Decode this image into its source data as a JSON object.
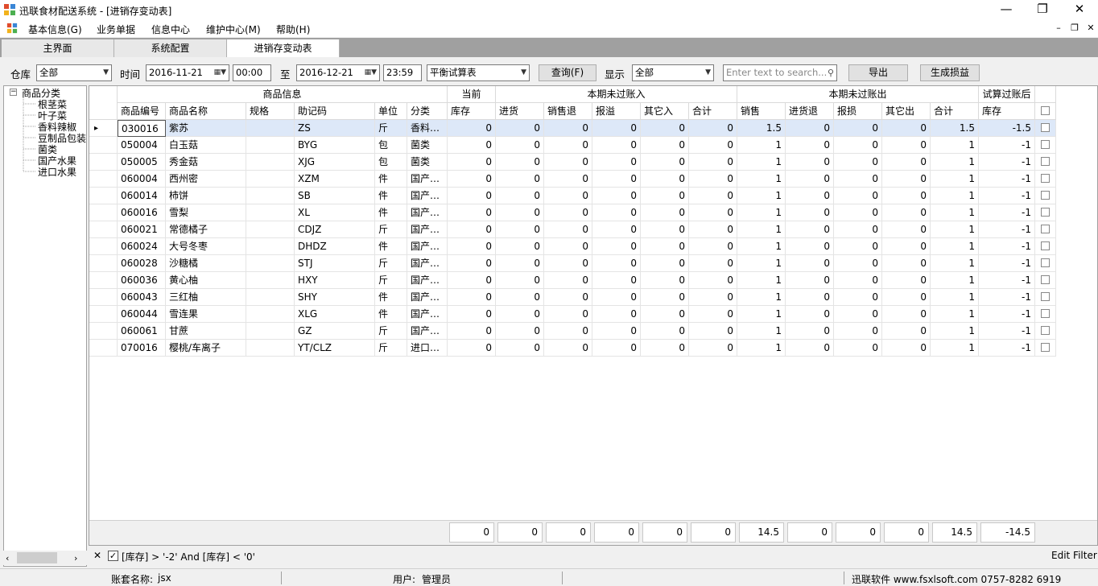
{
  "window": {
    "title": "迅联食材配送系统 - [进销存变动表]"
  },
  "menu": [
    "基本信息(G)",
    "业务单据",
    "信息中心",
    "维护中心(M)",
    "帮助(H)"
  ],
  "tabs": [
    "主界面",
    "系统配置",
    "进销存变动表"
  ],
  "toolbar": {
    "warehouse_label": "仓库",
    "warehouse_value": "全部",
    "time_label": "时间",
    "date_from": "2016-11-21",
    "time_from": "00:00",
    "to_label": "至",
    "date_to": "2016-12-21",
    "time_to": "23:59",
    "mode_value": "平衡试算表",
    "query_button": "查询(F)",
    "display_label": "显示",
    "display_value": "全部",
    "search_placeholder": "Enter text to search...",
    "export_button": "导出",
    "loss_button": "生成损益"
  },
  "tree": {
    "root": "商品分类",
    "children": [
      "根茎菜",
      "叶子菜",
      "香料辣椒",
      "豆制品包装",
      "菌类",
      "国产水果",
      "进口水果"
    ]
  },
  "grid": {
    "bands": [
      "商品信息",
      "当前",
      "本期未过账入",
      "本期未过账出",
      "试算过账后"
    ],
    "columns": [
      "商品编号",
      "商品名称",
      "规格",
      "助记码",
      "单位",
      "分类",
      "库存",
      "进货",
      "销售退",
      "报溢",
      "其它入",
      "合计",
      "销售",
      "进货退",
      "报损",
      "其它出",
      "合计",
      "库存"
    ],
    "rows": [
      [
        "030016",
        "紫苏",
        "",
        "ZS",
        "斤",
        "香料…",
        "0",
        "0",
        "0",
        "0",
        "0",
        "0",
        "1.5",
        "0",
        "0",
        "0",
        "1.5",
        "-1.5"
      ],
      [
        "050004",
        "白玉菇",
        "",
        "BYG",
        "包",
        "菌类",
        "0",
        "0",
        "0",
        "0",
        "0",
        "0",
        "1",
        "0",
        "0",
        "0",
        "1",
        "-1"
      ],
      [
        "050005",
        "秀金菇",
        "",
        "XJG",
        "包",
        "菌类",
        "0",
        "0",
        "0",
        "0",
        "0",
        "0",
        "1",
        "0",
        "0",
        "0",
        "1",
        "-1"
      ],
      [
        "060004",
        "西州密",
        "",
        "XZM",
        "件",
        "国产…",
        "0",
        "0",
        "0",
        "0",
        "0",
        "0",
        "1",
        "0",
        "0",
        "0",
        "1",
        "-1"
      ],
      [
        "060014",
        "柿饼",
        "",
        "SB",
        "件",
        "国产…",
        "0",
        "0",
        "0",
        "0",
        "0",
        "0",
        "1",
        "0",
        "0",
        "0",
        "1",
        "-1"
      ],
      [
        "060016",
        "雪梨",
        "",
        "XL",
        "件",
        "国产…",
        "0",
        "0",
        "0",
        "0",
        "0",
        "0",
        "1",
        "0",
        "0",
        "0",
        "1",
        "-1"
      ],
      [
        "060021",
        "常德橘子",
        "",
        "CDJZ",
        "斤",
        "国产…",
        "0",
        "0",
        "0",
        "0",
        "0",
        "0",
        "1",
        "0",
        "0",
        "0",
        "1",
        "-1"
      ],
      [
        "060024",
        "大号冬枣",
        "",
        "DHDZ",
        "件",
        "国产…",
        "0",
        "0",
        "0",
        "0",
        "0",
        "0",
        "1",
        "0",
        "0",
        "0",
        "1",
        "-1"
      ],
      [
        "060028",
        "沙糖橘",
        "",
        "STJ",
        "斤",
        "国产…",
        "0",
        "0",
        "0",
        "0",
        "0",
        "0",
        "1",
        "0",
        "0",
        "0",
        "1",
        "-1"
      ],
      [
        "060036",
        "黄心柚",
        "",
        "HXY",
        "斤",
        "国产…",
        "0",
        "0",
        "0",
        "0",
        "0",
        "0",
        "1",
        "0",
        "0",
        "0",
        "1",
        "-1"
      ],
      [
        "060043",
        "三红柚",
        "",
        "SHY",
        "件",
        "国产…",
        "0",
        "0",
        "0",
        "0",
        "0",
        "0",
        "1",
        "0",
        "0",
        "0",
        "1",
        "-1"
      ],
      [
        "060044",
        "雪连果",
        "",
        "XLG",
        "件",
        "国产…",
        "0",
        "0",
        "0",
        "0",
        "0",
        "0",
        "1",
        "0",
        "0",
        "0",
        "1",
        "-1"
      ],
      [
        "060061",
        "甘蔗",
        "",
        "GZ",
        "斤",
        "国产…",
        "0",
        "0",
        "0",
        "0",
        "0",
        "0",
        "1",
        "0",
        "0",
        "0",
        "1",
        "-1"
      ],
      [
        "070016",
        "樱桃/车离子",
        "",
        "YT/CLZ",
        "斤",
        "进口…",
        "0",
        "0",
        "0",
        "0",
        "0",
        "0",
        "1",
        "0",
        "0",
        "0",
        "1",
        "-1"
      ]
    ],
    "totals": [
      "0",
      "0",
      "0",
      "0",
      "0",
      "0",
      "14.5",
      "0",
      "0",
      "0",
      "14.5",
      "-14.5"
    ]
  },
  "filter": {
    "expression": "[库存] > '-2' And [库存] < '0'",
    "edit_label": "Edit Filter"
  },
  "status": {
    "account_label": "账套名称:",
    "account_value": "jsx",
    "user_label": "用户:",
    "user_value": "管理员",
    "company": "迅联软件 www.fsxlsoft.com 0757-8282 6919"
  }
}
